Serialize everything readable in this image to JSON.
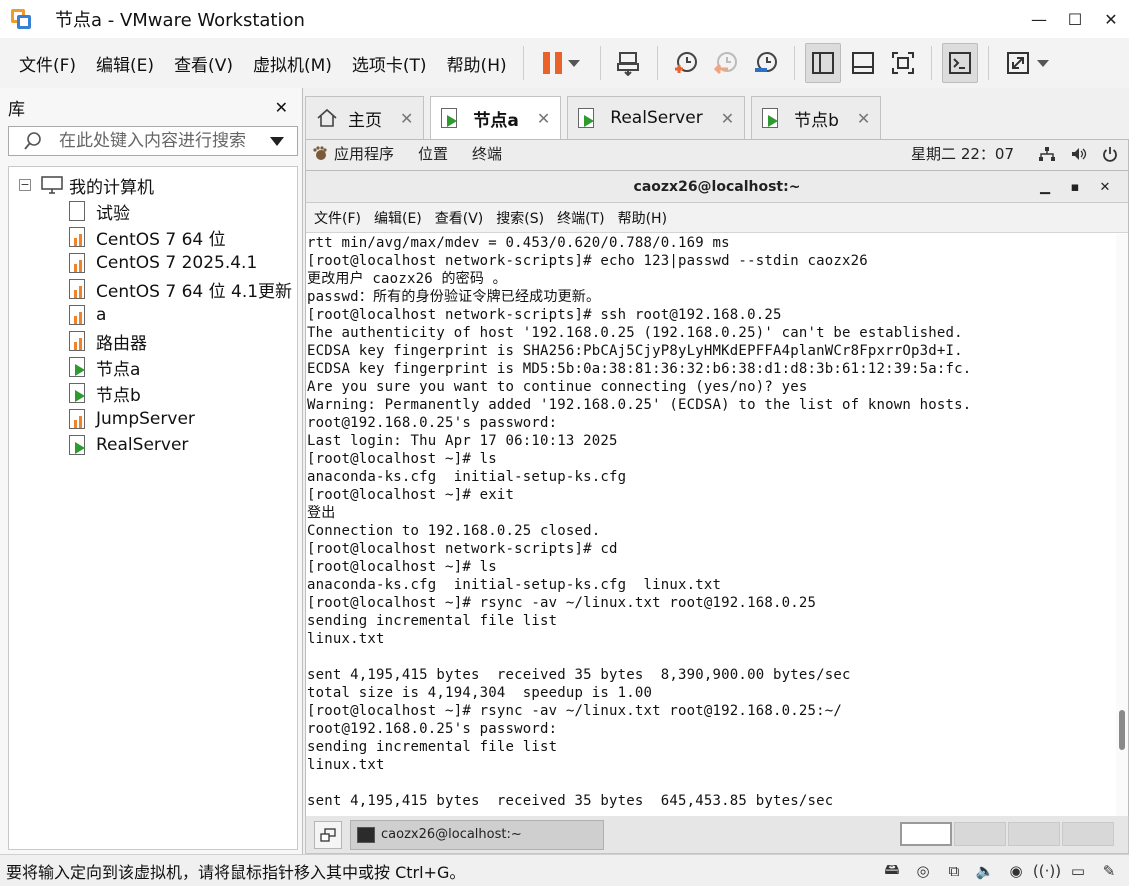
{
  "window": {
    "title": "节点a - VMware Workstation",
    "minimize": "—",
    "maximize": "☐",
    "close": "✕"
  },
  "menubar": {
    "items": [
      "文件(F)",
      "编辑(E)",
      "查看(V)",
      "虚拟机(M)",
      "选项卡(T)",
      "帮助(H)"
    ]
  },
  "toolbar": {
    "icons": [
      "pause-icon",
      "send-ctrl-alt-del-icon",
      "snapshot-take-icon",
      "snapshot-revert-icon",
      "snapshot-manager-icon",
      "library-view-icon",
      "thumbnail-view-icon",
      "fullscreen-icon",
      "console-view-icon",
      "stretch-icon"
    ],
    "pause_color": "#e8622a"
  },
  "library": {
    "title": "库",
    "close": "✕",
    "search_placeholder": "在此处键入内容进行搜索",
    "root": {
      "label": "我的计算机",
      "toggle": "−"
    },
    "items": [
      {
        "label": "试验",
        "state": "off"
      },
      {
        "label": "CentOS 7 64 位",
        "state": "suspended"
      },
      {
        "label": "CentOS 7 2025.4.1",
        "state": "suspended"
      },
      {
        "label": "CentOS 7 64 位 4.1更新",
        "state": "suspended"
      },
      {
        "label": "a",
        "state": "suspended"
      },
      {
        "label": "路由器",
        "state": "suspended"
      },
      {
        "label": "节点a",
        "state": "running"
      },
      {
        "label": "节点b",
        "state": "running"
      },
      {
        "label": "JumpServer",
        "state": "suspended"
      },
      {
        "label": "RealServer",
        "state": "running"
      }
    ]
  },
  "tabs": [
    {
      "label": "主页",
      "icon": "home-icon",
      "close": "✕",
      "active": false
    },
    {
      "label": "节点a",
      "icon": "vm-running-icon",
      "close": "✕",
      "active": true
    },
    {
      "label": "RealServer",
      "icon": "vm-running-icon",
      "close": "✕",
      "active": false
    },
    {
      "label": "节点b",
      "icon": "vm-running-icon",
      "close": "✕",
      "active": false
    }
  ],
  "gnome_panel": {
    "applications": "应用程序",
    "places": "位置",
    "terminal": "终端",
    "clock": "星期二 22：07"
  },
  "terminal": {
    "title": "caozx26@localhost:~",
    "menu": [
      "文件(F)",
      "编辑(E)",
      "查看(V)",
      "搜索(S)",
      "终端(T)",
      "帮助(H)"
    ],
    "lines": [
      "rtt min/avg/max/mdev = 0.453/0.620/0.788/0.169 ms",
      "[root@localhost network-scripts]# echo 123|passwd --stdin caozx26",
      "更改用户 caozx26 的密码 。",
      "passwd：所有的身份验证令牌已经成功更新。",
      "[root@localhost network-scripts]# ssh root@192.168.0.25",
      "The authenticity of host '192.168.0.25 (192.168.0.25)' can't be established.",
      "ECDSA key fingerprint is SHA256:PbCAj5CjyP8yLyHMKdEPFFA4planWCr8FpxrrOp3d+I.",
      "ECDSA key fingerprint is MD5:5b:0a:38:81:36:32:b6:38:d1:d8:3b:61:12:39:5a:fc.",
      "Are you sure you want to continue connecting (yes/no)? yes",
      "Warning: Permanently added '192.168.0.25' (ECDSA) to the list of known hosts.",
      "root@192.168.0.25's password:",
      "Last login: Thu Apr 17 06:10:13 2025",
      "[root@localhost ~]# ls",
      "anaconda-ks.cfg  initial-setup-ks.cfg",
      "[root@localhost ~]# exit",
      "登出",
      "Connection to 192.168.0.25 closed.",
      "[root@localhost network-scripts]# cd",
      "[root@localhost ~]# ls",
      "anaconda-ks.cfg  initial-setup-ks.cfg  linux.txt",
      "[root@localhost ~]# rsync -av ~/linux.txt root@192.168.0.25",
      "sending incremental file list",
      "linux.txt",
      "",
      "sent 4,195,415 bytes  received 35 bytes  8,390,900.00 bytes/sec",
      "total size is 4,194,304  speedup is 1.00",
      "[root@localhost ~]# rsync -av ~/linux.txt root@192.168.0.25:~/",
      "root@192.168.0.25's password:",
      "sending incremental file list",
      "linux.txt",
      "",
      "sent 4,195,415 bytes  received 35 bytes  645,453.85 bytes/sec"
    ]
  },
  "guest_taskbar": {
    "task_label": "caozx26@localhost:~"
  },
  "statusbar": {
    "message": "要将输入定向到该虚拟机，请将鼠标指针移入其中或按 Ctrl+G。"
  }
}
